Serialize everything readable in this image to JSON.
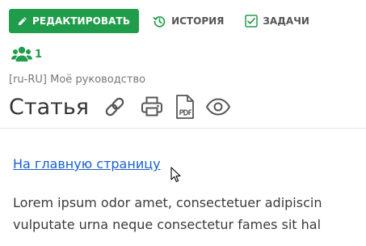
{
  "toolbar": {
    "edit_label": "РЕДАКТИРОВАТЬ",
    "history_label": "ИСТОРИЯ",
    "tasks_label": "ЗАДАЧИ"
  },
  "users": {
    "count": "1"
  },
  "space": {
    "label": "[ru-RU] Моё руководство"
  },
  "article": {
    "title": "Статья",
    "actions": [
      "link-icon",
      "print-icon",
      "pdf-icon",
      "view-icon"
    ]
  },
  "content": {
    "home_link": "На главную страницу",
    "paragraph_lines": [
      "Lorem ipsum odor amet, consectetuer adipiscin",
      "vulputate urna neque consectetur fames sit hal"
    ]
  },
  "colors": {
    "accent": "#1f9d4a",
    "link": "#1a5fcf",
    "text": "#333333"
  }
}
